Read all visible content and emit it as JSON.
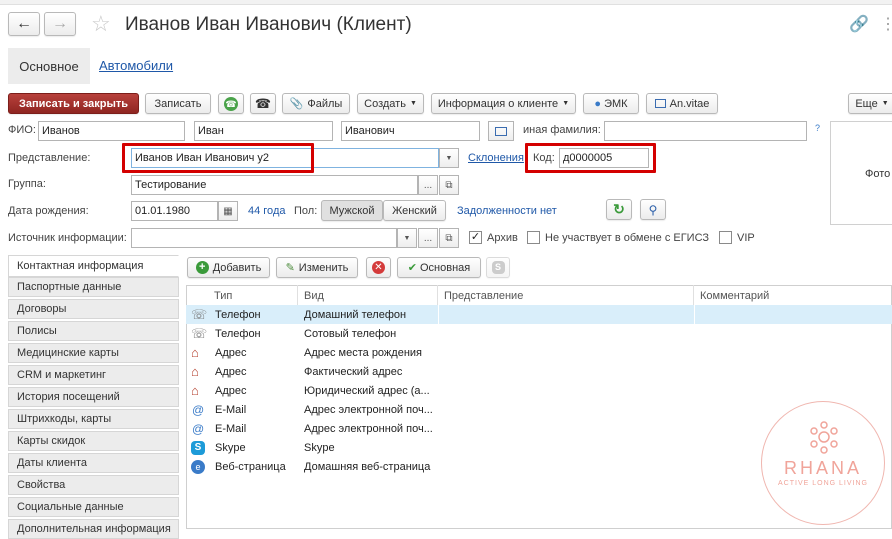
{
  "header": {
    "title": "Иванов Иван Иванович (Клиент)"
  },
  "tabs": {
    "main": "Основное",
    "cars": "Автомобили"
  },
  "toolbar": {
    "save_close": "Записать и закрыть",
    "save": "Записать",
    "files": "Файлы",
    "create": "Создать",
    "client_info": "Информация о клиенте",
    "emk": "ЭМК",
    "anvitae": "An.vitae",
    "more": "Еще"
  },
  "form": {
    "fio_label": "ФИО:",
    "last_name": "Иванов",
    "first_name": "Иван",
    "middle_name": "Иванович",
    "other_surname_label": "иная фамилия:",
    "other_surname": "",
    "help_mark": "?",
    "repr_label": "Представление:",
    "repr_value": "Иванов Иван Иванович у2",
    "declensions_link": "Склонения",
    "code_label": "Код:",
    "code_value": "д0000005",
    "group_label": "Группа:",
    "group_value": "Тестирование",
    "birth_label": "Дата рождения:",
    "birth_value": "01.01.1980",
    "age_text": "44 года",
    "gender_label": "Пол:",
    "gender_male": "Мужской",
    "gender_female": "Женский",
    "debt_text": "Задолженности нет",
    "source_label": "Источник информации:",
    "source_value": "",
    "archive_label": "Архив",
    "archive_checked": true,
    "egisz_label": "Не участвует в обмене с ЕГИСЗ",
    "egisz_checked": false,
    "vip_label": "VIP",
    "vip_checked": false,
    "photo_label": "Фото"
  },
  "sidebar": {
    "items": [
      "Контактная информация",
      "Паспортные данные",
      "Договоры",
      "Полисы",
      "Медицинские карты",
      "CRM и маркетинг",
      "История посещений",
      "Штрихкоды, карты",
      "Карты скидок",
      "Даты клиента",
      "Свойства",
      "Социальные данные",
      "Дополнительная информация"
    ]
  },
  "contacts_toolbar": {
    "add": "Добавить",
    "edit": "Изменить",
    "main": "Основная"
  },
  "table": {
    "columns": [
      "Тип",
      "Вид",
      "Представление",
      "Комментарий"
    ],
    "rows": [
      {
        "icon": "phone-icon",
        "type": "Телефон",
        "kind": "Домашний телефон",
        "repr": "",
        "comment": ""
      },
      {
        "icon": "phone-icon",
        "type": "Телефон",
        "kind": "Сотовый телефон",
        "repr": "",
        "comment": ""
      },
      {
        "icon": "house-icon",
        "type": "Адрес",
        "kind": "Адрес места рождения",
        "repr": "",
        "comment": ""
      },
      {
        "icon": "house-icon",
        "type": "Адрес",
        "kind": "Фактический адрес",
        "repr": "",
        "comment": ""
      },
      {
        "icon": "house-icon",
        "type": "Адрес",
        "kind": "Юридический адрес (а...",
        "repr": "",
        "comment": ""
      },
      {
        "icon": "at-icon",
        "type": "E-Mail",
        "kind": "Адрес электронной поч...",
        "repr": "",
        "comment": ""
      },
      {
        "icon": "at-icon",
        "type": "E-Mail",
        "kind": "Адрес электронной поч...",
        "repr": "",
        "comment": ""
      },
      {
        "icon": "skype-icon",
        "type": "Skype",
        "kind": "Skype",
        "repr": "",
        "comment": ""
      },
      {
        "icon": "globe-icon",
        "type": "Веб-страница",
        "kind": "Домашняя веб-страница",
        "repr": "",
        "comment": ""
      }
    ]
  },
  "watermark": {
    "brand": "RHANA",
    "tagline": "ACTIVE LONG LIVING"
  },
  "colors": {
    "accent_red": "#d40000",
    "primary_button": "#a4322e",
    "link": "#1f58a8",
    "selection": "#d9eefa"
  }
}
